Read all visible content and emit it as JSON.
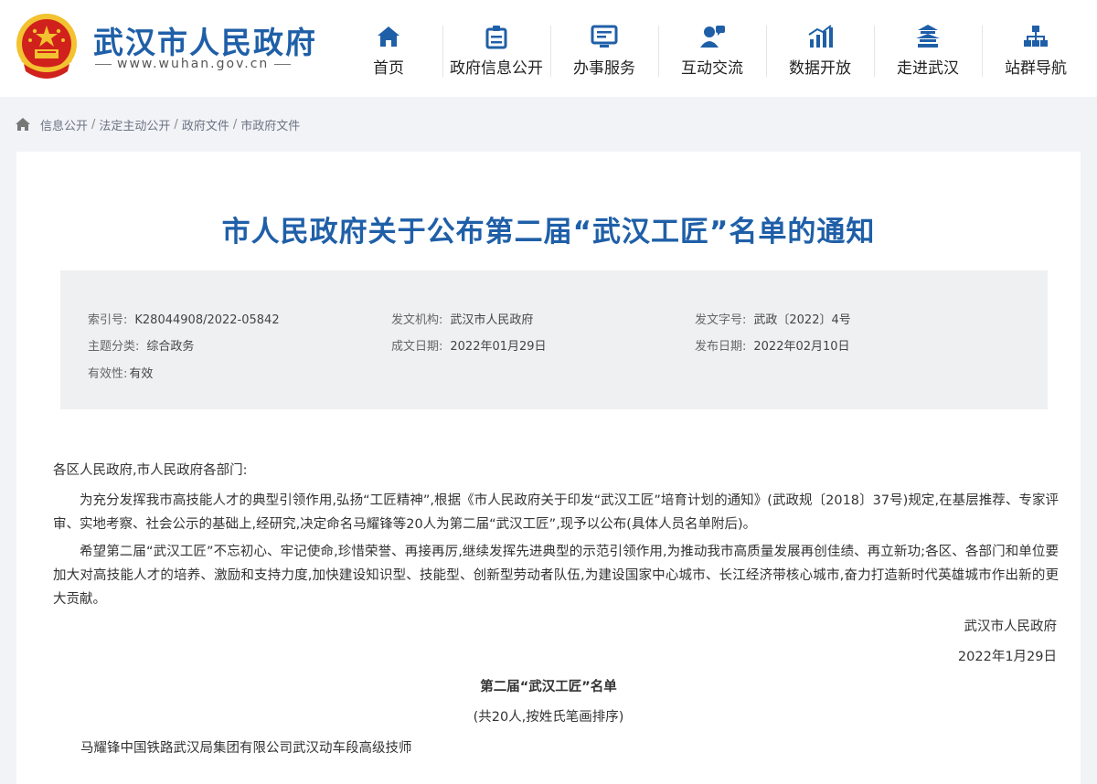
{
  "header": {
    "site_name": "武汉市人民政府",
    "site_url": "www.wuhan.gov.cn",
    "nav": [
      {
        "label": "首页",
        "icon": "home-icon"
      },
      {
        "label": "政府信息公开",
        "icon": "info-public-icon"
      },
      {
        "label": "办事服务",
        "icon": "service-icon"
      },
      {
        "label": "互动交流",
        "icon": "interaction-icon"
      },
      {
        "label": "数据开放",
        "icon": "data-chart-icon"
      },
      {
        "label": "走进武汉",
        "icon": "pavilion-icon"
      },
      {
        "label": "站群导航",
        "icon": "sitemap-icon"
      }
    ],
    "colors": {
      "brand": "#1f5fa8",
      "emblem_red": "#d0211c",
      "emblem_gold": "#f2c230"
    }
  },
  "breadcrumb": [
    "信息公开",
    "法定主动公开",
    "政府文件",
    "市政府文件"
  ],
  "doc": {
    "title": "市人民政府关于公布第二届“武汉工匠”名单的通知",
    "meta": {
      "index_label": "索引号:",
      "index_value": "K28044908/2022-05842",
      "org_label": "发文机构:",
      "org_value": "武汉市人民政府",
      "number_label": "发文字号:",
      "number_value": "武政〔2022〕4号",
      "topic_label": "主题分类:",
      "topic_value": "综合政务",
      "created_label": "成文日期:",
      "created_value": "2022年01月29日",
      "published_label": "发布日期:",
      "published_value": "2022年02月10日",
      "validity_label": "有效性:",
      "validity_value": "有效"
    },
    "salutation": "各区人民政府,市人民政府各部门:",
    "paragraph1": "为充分发挥我市高技能人才的典型引领作用,弘扬“工匠精神”,根据《市人民政府关于印发“武汉工匠”培育计划的通知》(武政规〔2018〕37号)规定,在基层推荐、专家评审、实地考察、社会公示的基础上,经研究,决定命名马耀锋等20人为第二届“武汉工匠”,现予以公布(具体人员名单附后)。",
    "paragraph2": "希望第二届“武汉工匠”不忘初心、牢记使命,珍惜荣誉、再接再厉,继续发挥先进典型的示范引领作用,为推动我市高质量发展再创佳绩、再立新功;各区、各部门和单位要加大对高技能人才的培养、激励和支持力度,加快建设知识型、技能型、创新型劳动者队伍,为建设国家中心城市、长江经济带核心城市,奋力打造新时代英雄城市作出新的更大贡献。",
    "signature": "武汉市人民政府",
    "date": "2022年1月29日",
    "list_title": "第二届“武汉工匠”名单",
    "list_note": "(共20人,按姓氏笔画排序)",
    "first_entry": "马耀锋中国铁路武汉局集团有限公司武汉动车段高级技师"
  }
}
